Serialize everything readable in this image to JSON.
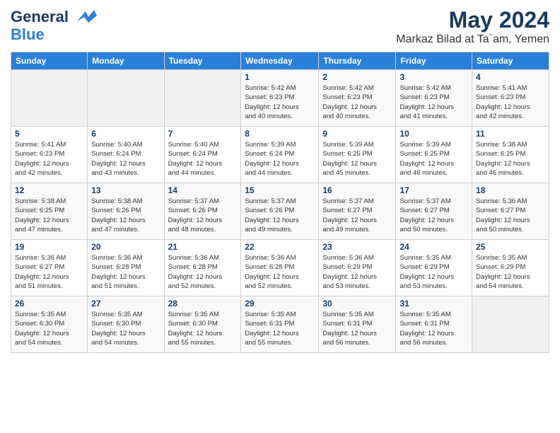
{
  "header": {
    "logo_general": "General",
    "logo_blue": "Blue",
    "month_title": "May 2024",
    "location": "Markaz Bilad at Ta`am, Yemen"
  },
  "days_of_week": [
    "Sunday",
    "Monday",
    "Tuesday",
    "Wednesday",
    "Thursday",
    "Friday",
    "Saturday"
  ],
  "weeks": [
    [
      {
        "day": "",
        "info": ""
      },
      {
        "day": "",
        "info": ""
      },
      {
        "day": "",
        "info": ""
      },
      {
        "day": "1",
        "info": "Sunrise: 5:42 AM\nSunset: 6:23 PM\nDaylight: 12 hours\nand 40 minutes."
      },
      {
        "day": "2",
        "info": "Sunrise: 5:42 AM\nSunset: 6:23 PM\nDaylight: 12 hours\nand 40 minutes."
      },
      {
        "day": "3",
        "info": "Sunrise: 5:42 AM\nSunset: 6:23 PM\nDaylight: 12 hours\nand 41 minutes."
      },
      {
        "day": "4",
        "info": "Sunrise: 5:41 AM\nSunset: 6:23 PM\nDaylight: 12 hours\nand 42 minutes."
      }
    ],
    [
      {
        "day": "5",
        "info": "Sunrise: 5:41 AM\nSunset: 6:23 PM\nDaylight: 12 hours\nand 42 minutes."
      },
      {
        "day": "6",
        "info": "Sunrise: 5:40 AM\nSunset: 6:24 PM\nDaylight: 12 hours\nand 43 minutes."
      },
      {
        "day": "7",
        "info": "Sunrise: 5:40 AM\nSunset: 6:24 PM\nDaylight: 12 hours\nand 44 minutes."
      },
      {
        "day": "8",
        "info": "Sunrise: 5:39 AM\nSunset: 6:24 PM\nDaylight: 12 hours\nand 44 minutes."
      },
      {
        "day": "9",
        "info": "Sunrise: 5:39 AM\nSunset: 6:25 PM\nDaylight: 12 hours\nand 45 minutes."
      },
      {
        "day": "10",
        "info": "Sunrise: 5:39 AM\nSunset: 6:25 PM\nDaylight: 12 hours\nand 46 minutes."
      },
      {
        "day": "11",
        "info": "Sunrise: 5:38 AM\nSunset: 6:25 PM\nDaylight: 12 hours\nand 46 minutes."
      }
    ],
    [
      {
        "day": "12",
        "info": "Sunrise: 5:38 AM\nSunset: 6:25 PM\nDaylight: 12 hours\nand 47 minutes."
      },
      {
        "day": "13",
        "info": "Sunrise: 5:38 AM\nSunset: 6:26 PM\nDaylight: 12 hours\nand 47 minutes."
      },
      {
        "day": "14",
        "info": "Sunrise: 5:37 AM\nSunset: 6:26 PM\nDaylight: 12 hours\nand 48 minutes."
      },
      {
        "day": "15",
        "info": "Sunrise: 5:37 AM\nSunset: 6:26 PM\nDaylight: 12 hours\nand 49 minutes."
      },
      {
        "day": "16",
        "info": "Sunrise: 5:37 AM\nSunset: 6:27 PM\nDaylight: 12 hours\nand 49 minutes."
      },
      {
        "day": "17",
        "info": "Sunrise: 5:37 AM\nSunset: 6:27 PM\nDaylight: 12 hours\nand 50 minutes."
      },
      {
        "day": "18",
        "info": "Sunrise: 5:36 AM\nSunset: 6:27 PM\nDaylight: 12 hours\nand 50 minutes."
      }
    ],
    [
      {
        "day": "19",
        "info": "Sunrise: 5:36 AM\nSunset: 6:27 PM\nDaylight: 12 hours\nand 51 minutes."
      },
      {
        "day": "20",
        "info": "Sunrise: 5:36 AM\nSunset: 6:28 PM\nDaylight: 12 hours\nand 51 minutes."
      },
      {
        "day": "21",
        "info": "Sunrise: 5:36 AM\nSunset: 6:28 PM\nDaylight: 12 hours\nand 52 minutes."
      },
      {
        "day": "22",
        "info": "Sunrise: 5:36 AM\nSunset: 6:28 PM\nDaylight: 12 hours\nand 52 minutes."
      },
      {
        "day": "23",
        "info": "Sunrise: 5:36 AM\nSunset: 6:29 PM\nDaylight: 12 hours\nand 53 minutes."
      },
      {
        "day": "24",
        "info": "Sunrise: 5:35 AM\nSunset: 6:29 PM\nDaylight: 12 hours\nand 53 minutes."
      },
      {
        "day": "25",
        "info": "Sunrise: 5:35 AM\nSunset: 6:29 PM\nDaylight: 12 hours\nand 54 minutes."
      }
    ],
    [
      {
        "day": "26",
        "info": "Sunrise: 5:35 AM\nSunset: 6:30 PM\nDaylight: 12 hours\nand 54 minutes."
      },
      {
        "day": "27",
        "info": "Sunrise: 5:35 AM\nSunset: 6:30 PM\nDaylight: 12 hours\nand 54 minutes."
      },
      {
        "day": "28",
        "info": "Sunrise: 5:35 AM\nSunset: 6:30 PM\nDaylight: 12 hours\nand 55 minutes."
      },
      {
        "day": "29",
        "info": "Sunrise: 5:35 AM\nSunset: 6:31 PM\nDaylight: 12 hours\nand 55 minutes."
      },
      {
        "day": "30",
        "info": "Sunrise: 5:35 AM\nSunset: 6:31 PM\nDaylight: 12 hours\nand 56 minutes."
      },
      {
        "day": "31",
        "info": "Sunrise: 5:35 AM\nSunset: 6:31 PM\nDaylight: 12 hours\nand 56 minutes."
      },
      {
        "day": "",
        "info": ""
      }
    ]
  ]
}
